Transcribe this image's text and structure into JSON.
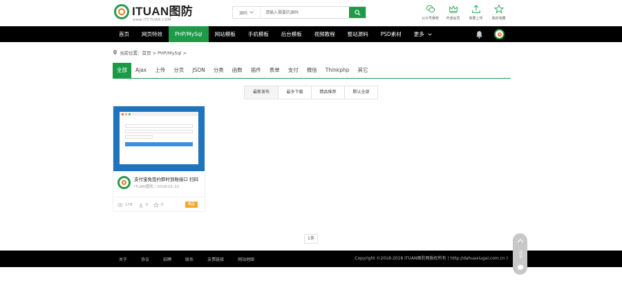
{
  "header": {
    "logo_text": "ITUAN图防",
    "logo_sub": "www.ITCTUAN.COM",
    "search_category": "源码",
    "search_placeholder": "请输入需要的源码",
    "icons": [
      {
        "name": "wechat-icon",
        "label": "公众号推荐"
      },
      {
        "name": "crown-icon",
        "label": "开通会员"
      },
      {
        "name": "upload-icon",
        "label": "我要上传"
      },
      {
        "name": "star-icon",
        "label": "我的收藏"
      }
    ]
  },
  "nav": {
    "items": [
      "首页",
      "网页特效",
      "PHP/MySql",
      "网站模板",
      "手机模板",
      "后台模板",
      "视频教程",
      "整站源码",
      "PSD素材",
      "更多"
    ],
    "active_index": 2
  },
  "breadcrumb": "当前位置：首页 > PHP/MySql >",
  "categories": {
    "items": [
      "全部",
      "Ajax",
      "上传",
      "分页",
      "JSON",
      "分类",
      "函数",
      "插件",
      "表单",
      "支付",
      "微信",
      "Thinkphp",
      "其它"
    ],
    "active_index": 0
  },
  "sorts": [
    "最新发布",
    "最多下载",
    "精品推荐",
    "默认全部"
  ],
  "card": {
    "title": "支付宝免签约即时到账接口 扫码",
    "author": "ITUAN图防",
    "date": "/ 2018-01-22",
    "views": "178",
    "downloads": "0",
    "favorites": "0",
    "badge": "精品"
  },
  "pager": "1条",
  "footer": {
    "links": [
      "关于",
      "协议",
      "招聘",
      "联系",
      "友情链接",
      "网站地图"
    ],
    "copyright": "Copyright ©2018-2018 ITUAN图防网版权所有 ( http://dahuaxiugai.com.cn )"
  },
  "float": {
    "mid_label": "评论"
  },
  "colors": {
    "brand": "#1c9a48",
    "nav_bg": "#000000",
    "thumb_bg": "#1f74be",
    "badge": "#f5a623"
  }
}
